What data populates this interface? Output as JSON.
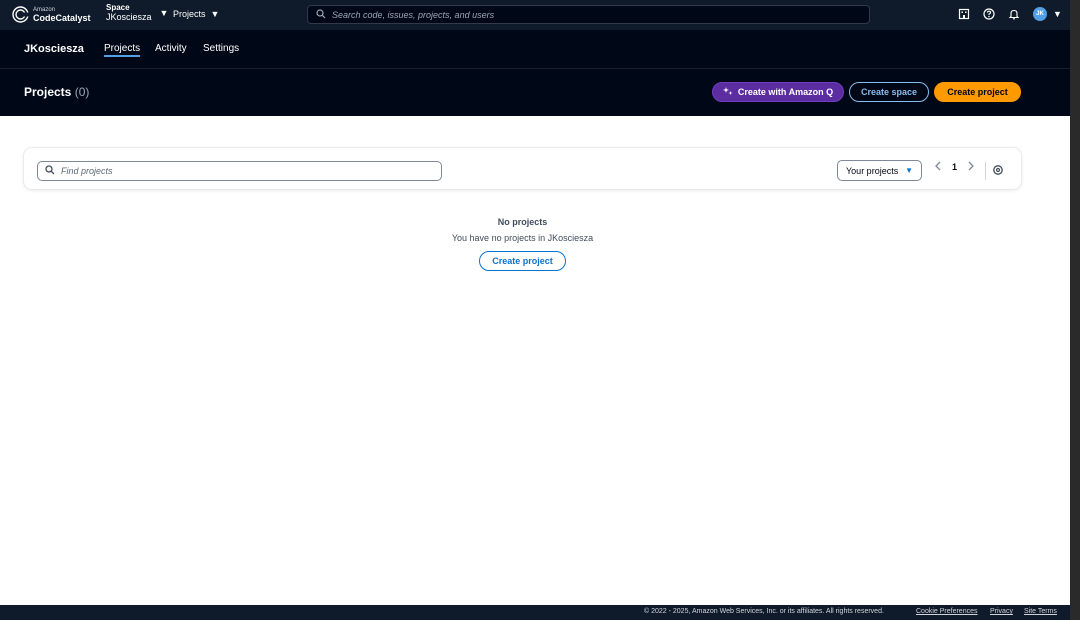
{
  "topbar": {
    "logo_small": "Amazon",
    "logo_big": "CodeCatalyst",
    "space_label": "Space",
    "space_value": "JKosciesza",
    "projects_label": "Projects",
    "search_placeholder": "Search code, issues, projects, and users",
    "avatar_initials": "JK",
    "icons": [
      "search-icon",
      "building-icon",
      "help-icon",
      "bell-icon",
      "avatar"
    ]
  },
  "space_nav": {
    "space_name": "JKosciesza",
    "tabs": [
      {
        "label": "Projects",
        "active": true
      },
      {
        "label": "Activity",
        "active": false
      },
      {
        "label": "Settings",
        "active": false
      }
    ]
  },
  "header": {
    "title": "Projects",
    "count": "(0)",
    "buttons": {
      "create_with_q": "Create with Amazon Q",
      "create_space": "Create space",
      "create_project": "Create project"
    }
  },
  "filter": {
    "find_placeholder": "Find projects",
    "scope_selected": "Your projects",
    "current_page": "1"
  },
  "empty_state": {
    "title": "No projects",
    "description": "You have no projects in JKosciesza",
    "button": "Create project"
  },
  "footer": {
    "copyright": "© 2022 - 2025, Amazon Web Services, Inc. or its affiliates. All rights reserved.",
    "links": [
      "Cookie Preferences",
      "Privacy",
      "Site Terms"
    ]
  },
  "colors": {
    "topbar_bg": "#0f1b2a",
    "header_bg": "#000716",
    "accent_blue": "#0972d3",
    "q_purple": "#5c2ca1",
    "primary_orange": "#ff9900"
  }
}
